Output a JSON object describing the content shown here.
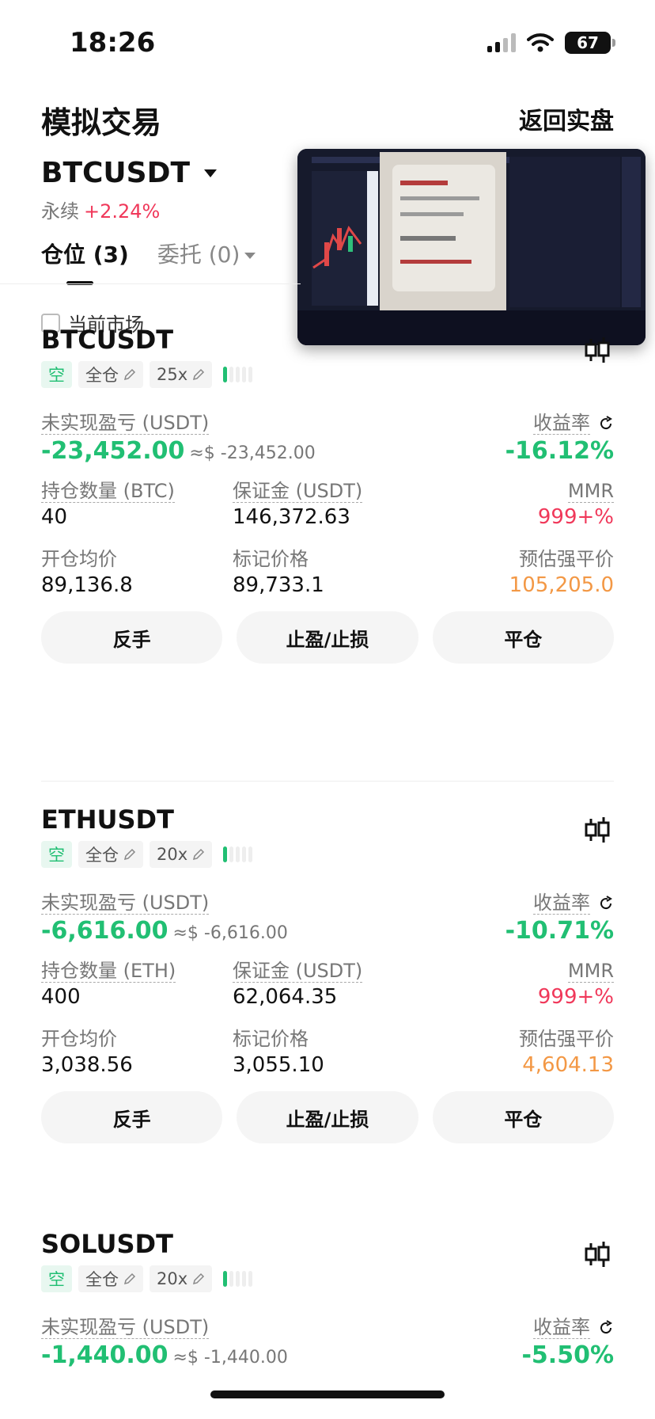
{
  "status": {
    "time": "18:26",
    "battery": "67"
  },
  "header": {
    "title": "模拟交易",
    "back_label": "返回实盘"
  },
  "market": {
    "symbol": "BTCUSDT",
    "contract_type": "永续",
    "change_pct": "+2.24%"
  },
  "tabs": [
    {
      "label": "仓位 (3)",
      "active": true
    },
    {
      "label": "委托 (0)",
      "active": false
    }
  ],
  "filter": {
    "label": "当前市场",
    "checked": false
  },
  "labels": {
    "unrealized_pnl": "未实现盈亏 (USDT)",
    "roe": "收益率",
    "margin": "保证金 (USDT)",
    "mmr": "MMR",
    "entry_price": "开仓均价",
    "mark_price": "标记价格",
    "liq_price": "预估强平价",
    "reverse": "反手",
    "tpsl": "止盈/止损",
    "close": "平仓"
  },
  "positions": [
    {
      "symbol": "BTCUSDT",
      "side": "空",
      "margin_mode": "全仓",
      "leverage": "25x",
      "pnl": "-23,452.00",
      "pnl_usd": "≈$ -23,452.00",
      "roe": "-16.12%",
      "size_label": "持仓数量 (BTC)",
      "size": "40",
      "margin": "146,372.63",
      "mmr": "999+%",
      "entry": "89,136.8",
      "mark": "89,733.1",
      "liq": "105,205.0"
    },
    {
      "symbol": "ETHUSDT",
      "side": "空",
      "margin_mode": "全仓",
      "leverage": "20x",
      "pnl": "-6,616.00",
      "pnl_usd": "≈$ -6,616.00",
      "roe": "-10.71%",
      "size_label": "持仓数量 (ETH)",
      "size": "400",
      "margin": "62,064.35",
      "mmr": "999+%",
      "entry": "3,038.56",
      "mark": "3,055.10",
      "liq": "4,604.13"
    },
    {
      "symbol": "SOLUSDT",
      "side": "空",
      "margin_mode": "全仓",
      "leverage": "20x",
      "pnl": "-1,440.00",
      "pnl_usd": "≈$ -1,440.00",
      "roe": "-5.50%"
    }
  ],
  "colors": {
    "gain_green": "#21bf73",
    "loss_red": "#f0385a",
    "liq_orange": "#f39845"
  }
}
